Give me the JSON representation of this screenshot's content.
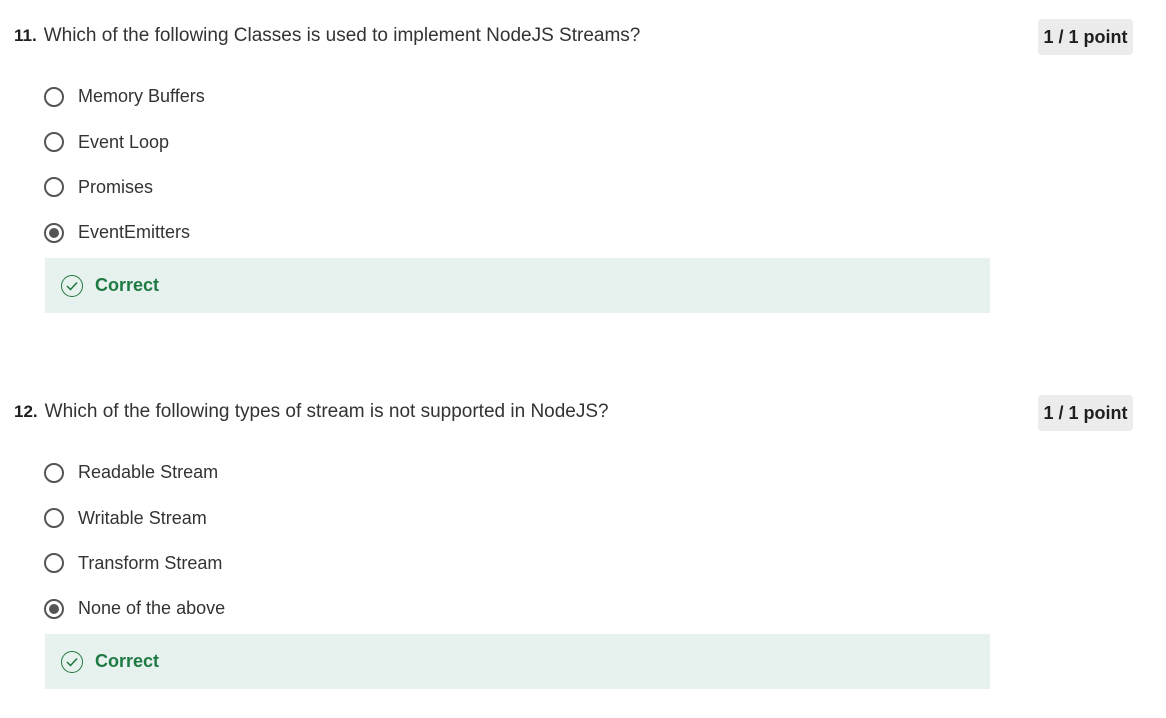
{
  "questions": [
    {
      "number": "11.",
      "text": "Which of the following Classes is used to implement NodeJS Streams?",
      "points": "1 / 1 point",
      "options": [
        {
          "label": "Memory Buffers",
          "selected": false
        },
        {
          "label": "Event Loop",
          "selected": false
        },
        {
          "label": "Promises",
          "selected": false
        },
        {
          "label": "EventEmitters",
          "selected": true
        }
      ],
      "feedback": "Correct"
    },
    {
      "number": "12.",
      "text": "Which of the following types of stream is not supported in NodeJS?",
      "points": "1 / 1 point",
      "options": [
        {
          "label": "Readable Stream",
          "selected": false
        },
        {
          "label": "Writable Stream",
          "selected": false
        },
        {
          "label": "Transform Stream",
          "selected": false
        },
        {
          "label": "None of the above",
          "selected": true
        }
      ],
      "feedback": "Correct"
    }
  ],
  "colors": {
    "feedback_bg": "#e7f1ed",
    "correct_green": "#1e7a43",
    "points_bg": "#ececec"
  },
  "icons": {
    "feedback": "check-circle-icon"
  }
}
